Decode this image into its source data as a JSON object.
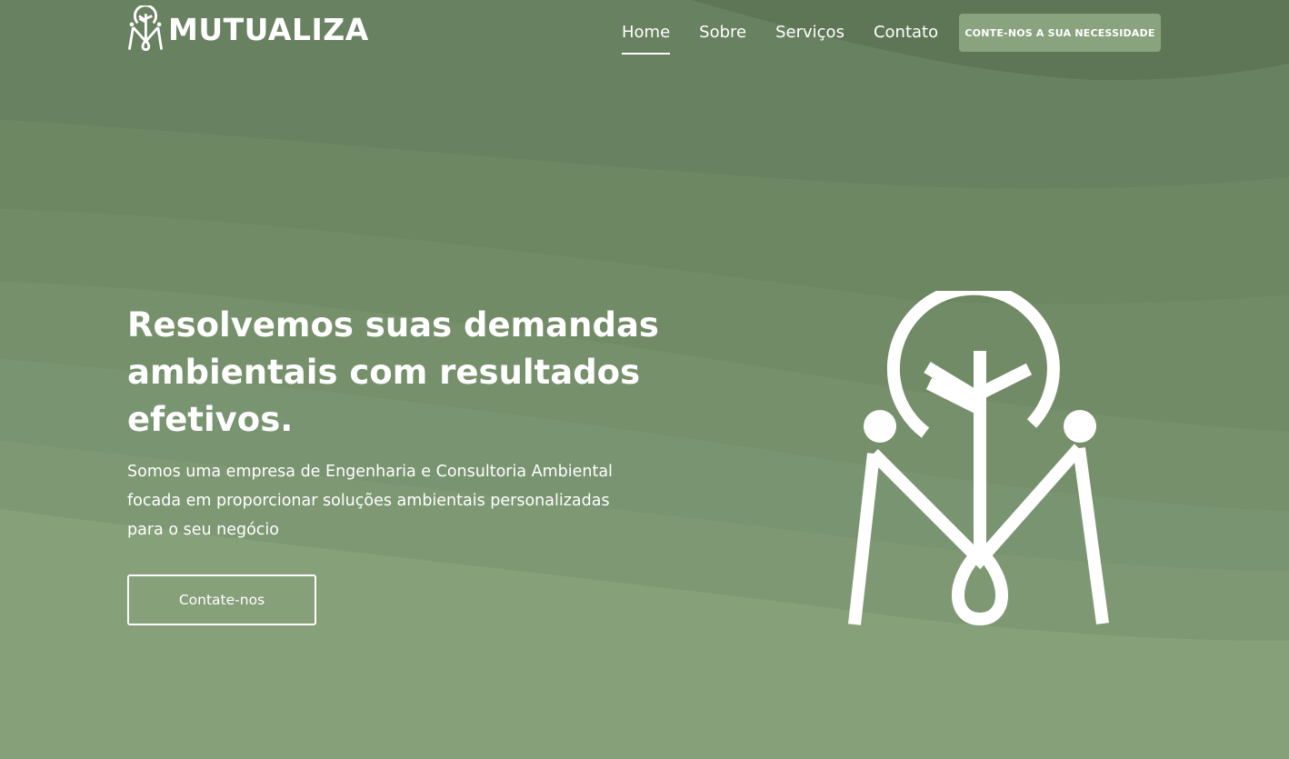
{
  "brand": {
    "name": "MUTUALIZA",
    "logo_icon": "mutualiza-logo-icon"
  },
  "nav": {
    "items": [
      {
        "label": "Home",
        "active": true
      },
      {
        "label": "Sobre",
        "active": false
      },
      {
        "label": "Serviços",
        "active": false
      },
      {
        "label": "Contato",
        "active": false
      }
    ],
    "cta_label": "CONTE-NOS A SUA NECESSIDADE"
  },
  "hero": {
    "title": "Resolvemos suas demandas ambientais com resultados efetivos.",
    "subtitle": "Somos uma empresa de Engenharia e Consultoria Ambiental focada em proporcionar soluções ambientais personalizadas para o seu negócio",
    "button_label": "Contate-nos",
    "illustration_icon": "mutualiza-emblem-icon"
  },
  "colors": {
    "background_top": "#5f7656",
    "background_bottom": "#86a07a",
    "cta_button": "#88a37e",
    "text": "#ffffff"
  }
}
